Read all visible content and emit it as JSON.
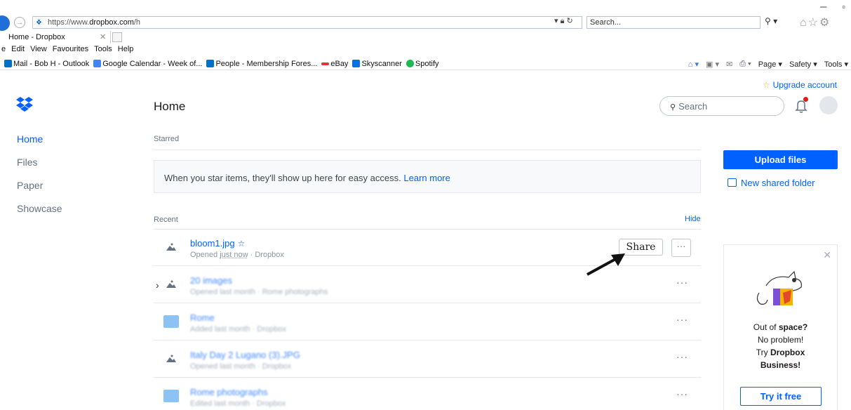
{
  "browser": {
    "url_prefix": "https://www.",
    "url_domain": "dropbox.com",
    "url_suffix": "/h",
    "search_placeholder": "Search...",
    "tab_title": "Home - Dropbox",
    "menu": [
      "e",
      "Edit",
      "View",
      "Favourites",
      "Tools",
      "Help"
    ],
    "favorites": [
      {
        "label": "Mail - Bob H - Outlook",
        "color": "#0072c6"
      },
      {
        "label": "Google Calendar - Week of...",
        "color": "#4285f4"
      },
      {
        "label": "People - Membership Fores...",
        "color": "#0072c6"
      },
      {
        "label": "eBay",
        "color": "#e53238"
      },
      {
        "label": "Skyscanner",
        "color": "#0770e3"
      },
      {
        "label": "Spotify",
        "color": "#1db954"
      }
    ],
    "commands": [
      "Page ▾",
      "Safety ▾",
      "Tools ▾"
    ]
  },
  "dropbox": {
    "upgrade_label": "Upgrade account",
    "nav": [
      "Home",
      "Files",
      "Paper",
      "Showcase"
    ],
    "page_title": "Home",
    "search_placeholder": "Search",
    "starred_label": "Starred",
    "starred_message": "When you star items, they'll show up here for easy access.",
    "learn_more": "Learn more",
    "recent_label": "Recent",
    "hide_label": "Hide",
    "share_label": "Share",
    "more_label": "···",
    "files": [
      {
        "name": "bloom1.jpg",
        "meta_prefix": "Opened ",
        "meta_time": "just now",
        "meta_suffix": " · Dropbox",
        "kind": "image",
        "starred": true
      },
      {
        "name": "20 images",
        "meta_prefix": "Opened last month · Rome photographs",
        "meta_time": "",
        "meta_suffix": "",
        "kind": "image",
        "expand": true
      },
      {
        "name": "Rome",
        "meta_prefix": "Added last month · Dropbox",
        "meta_time": "",
        "meta_suffix": "",
        "kind": "folder"
      },
      {
        "name": "Italy Day 2 Lugano (3).JPG",
        "meta_prefix": "Opened last month · Dropbox",
        "meta_time": "",
        "meta_suffix": "",
        "kind": "image"
      },
      {
        "name": "Rome photographs",
        "meta_prefix": "Edited last month · Dropbox",
        "meta_time": "",
        "meta_suffix": "",
        "kind": "folder"
      }
    ],
    "upload_label": "Upload files",
    "new_folder_label": "New shared folder",
    "promo": {
      "line1_pre": "Out of ",
      "line1_bold": "space?",
      "line2": "No problem!",
      "line3_pre": "Try ",
      "line3_bold": "Dropbox",
      "line4_bold": "Business!",
      "cta": "Try it free"
    },
    "colors": {
      "accent": "#0061fe",
      "notification": "#e21d12"
    }
  }
}
